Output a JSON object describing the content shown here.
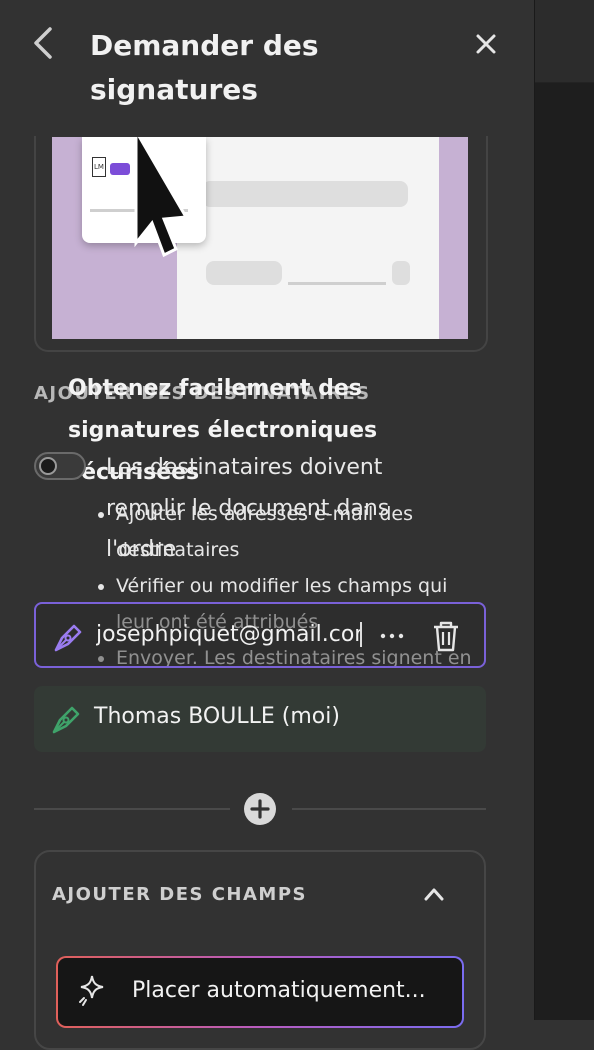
{
  "panel": {
    "title": "Demander des signatures",
    "back_icon": "chevron-left-icon",
    "close_icon": "close-icon"
  },
  "illustration": {
    "badge_text": "LM",
    "accent_color": "#7c4dd8",
    "background_color": "#c6b1d3"
  },
  "onboarding": {
    "title": "Obtenez facilement des signatures électroniques sécurisées",
    "bullets": [
      "Ajouter les adresses e-mail des destinataires",
      "Vérifier ou modifier les champs qui leur ont été attribués",
      "Envoyer. Les destinataires signent en ligne gratuitement."
    ]
  },
  "recipients_section": {
    "label": "AJOUTER DES DESTINATAIRES",
    "order_toggle": {
      "label": "Les destinataires doivent remplir le document dans l'ordre",
      "enabled": false
    },
    "recipients": [
      {
        "email": "josephpiquet@gmail.com",
        "icon": "pen-icon",
        "color": "#9a7cf0"
      },
      {
        "name": "Thomas BOULLE (moi)",
        "icon": "pen-icon",
        "color": "#3fa36a"
      }
    ],
    "more_icon": "more-icon",
    "delete_icon": "trash-icon",
    "add_icon": "plus-circle-icon"
  },
  "fields_section": {
    "title": "AJOUTER DES CHAMPS",
    "collapse_icon": "chevron-up-icon",
    "auto_place_label": "Placer automatiquement...",
    "auto_place_icon": "sparkle-icon"
  }
}
